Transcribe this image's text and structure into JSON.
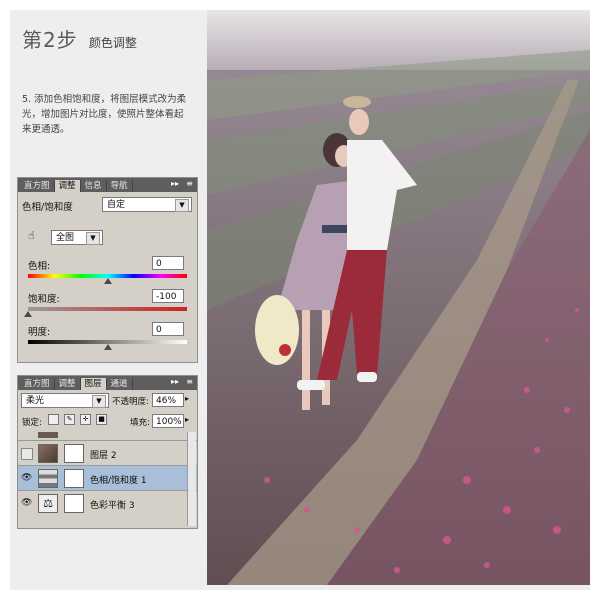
{
  "heading": {
    "step": "第2步",
    "subtitle": "颜色调整"
  },
  "instruction": "5. 添加色相饱和度，将图层模式改为柔光，增加图片对比度，使照片整体看起来更通透。",
  "adjustments_panel": {
    "tabs": [
      "直方图",
      "调整",
      "信息",
      "导航"
    ],
    "active_tab": "调整",
    "title": "色相/饱和度",
    "preset": "自定",
    "channel": "全图",
    "sliders": [
      {
        "label": "色相:",
        "value": "0",
        "level": 0.5
      },
      {
        "label": "饱和度:",
        "value": "-100",
        "level": 0.0
      },
      {
        "label": "明度:",
        "value": "0",
        "level": 0.5
      }
    ]
  },
  "layers_panel": {
    "tabs": [
      "直方图",
      "调整",
      "图层",
      "通道"
    ],
    "active_tab": "图层",
    "blend_mode": "柔光",
    "opacity_label": "不透明度:",
    "opacity": "46%",
    "lock_label": "锁定:",
    "fill_label": "填充:",
    "fill": "100%",
    "layers": [
      {
        "name": "图层 2",
        "visible": false,
        "selected": false
      },
      {
        "name": "色相/饱和度 1",
        "visible": true,
        "selected": true
      },
      {
        "name": "色彩平衡 3",
        "visible": true,
        "selected": false
      }
    ]
  },
  "colors": {
    "selected_layer": "#a9bfd9",
    "panel_bg": "#d4d0c8",
    "tab_bar": "#5e5e5e"
  }
}
